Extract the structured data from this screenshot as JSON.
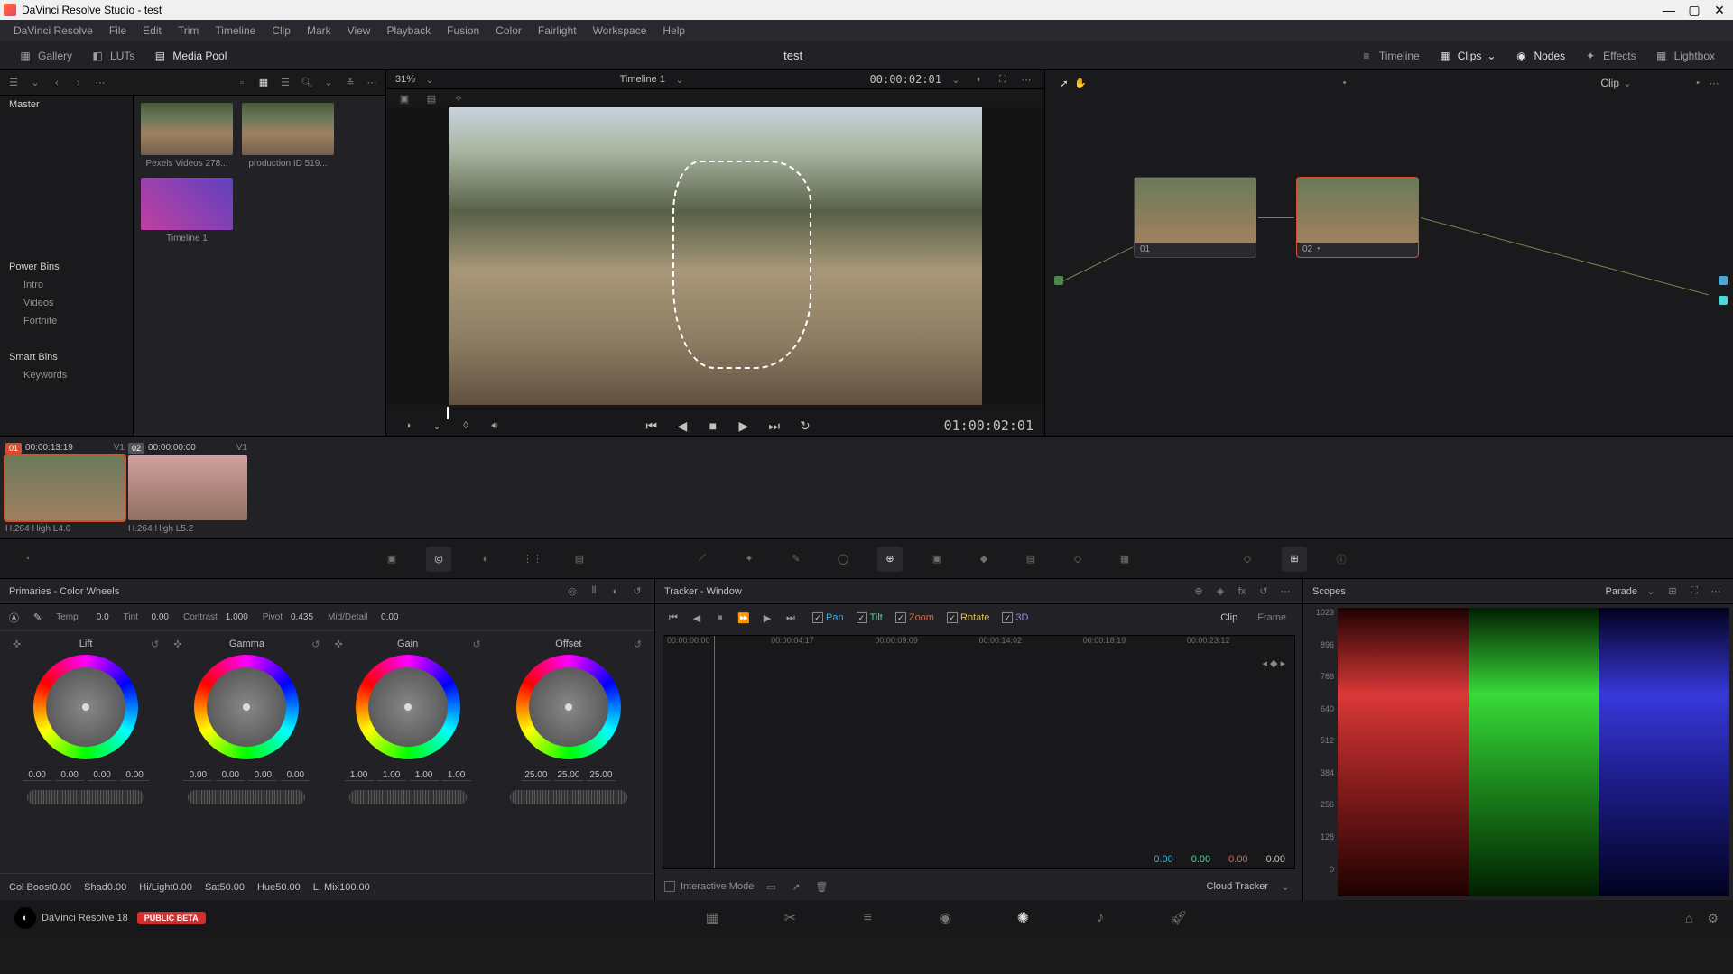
{
  "titlebar": {
    "title": "DaVinci Resolve Studio - test"
  },
  "menu": {
    "items": [
      "DaVinci Resolve",
      "File",
      "Edit",
      "Trim",
      "Timeline",
      "Clip",
      "Mark",
      "View",
      "Playback",
      "Fusion",
      "Color",
      "Fairlight",
      "Workspace",
      "Help"
    ]
  },
  "toolbar": {
    "gallery": "Gallery",
    "luts": "LUTs",
    "mediapool": "Media Pool",
    "project": "test",
    "timeline": "Timeline",
    "clips": "Clips",
    "nodes": "Nodes",
    "effects": "Effects",
    "lightbox": "Lightbox"
  },
  "mediapool": {
    "master": "Master",
    "power": "Power Bins",
    "power_items": [
      "Intro",
      "Videos",
      "Fortnite"
    ],
    "smart": "Smart Bins",
    "smart_items": [
      "Keywords"
    ],
    "clips": [
      "Pexels Videos 278...",
      "production ID 519...",
      "Timeline 1"
    ]
  },
  "viewer": {
    "zoom": "31%",
    "timeline_name": "Timeline 1",
    "tc_small": "00:00:02:01",
    "tc_big": "01:00:02:01"
  },
  "nodes": {
    "mode": "Clip",
    "n1": "01",
    "n2": "02"
  },
  "clipstrip": {
    "c1": {
      "num": "01",
      "tc": "00:00:13:19",
      "v": "V1",
      "codec": "H.264 High L4.0"
    },
    "c2": {
      "num": "02",
      "tc": "00:00:00:00",
      "v": "V1",
      "codec": "H.264 High L5.2"
    }
  },
  "wheels": {
    "header": "Primaries - Color Wheels",
    "params": {
      "temp_l": "Temp",
      "temp": "0.0",
      "tint_l": "Tint",
      "tint": "0.00",
      "contrast_l": "Contrast",
      "contrast": "1.000",
      "pivot_l": "Pivot",
      "pivot": "0.435",
      "mid_l": "Mid/Detail",
      "mid": "0.00"
    },
    "lift": {
      "name": "Lift",
      "v": [
        "0.00",
        "0.00",
        "0.00",
        "0.00"
      ]
    },
    "gamma": {
      "name": "Gamma",
      "v": [
        "0.00",
        "0.00",
        "0.00",
        "0.00"
      ]
    },
    "gain": {
      "name": "Gain",
      "v": [
        "1.00",
        "1.00",
        "1.00",
        "1.00"
      ]
    },
    "offset": {
      "name": "Offset",
      "v": [
        "25.00",
        "25.00",
        "25.00"
      ]
    },
    "params2": {
      "cb_l": "Col Boost",
      "cb": "0.00",
      "sh_l": "Shad",
      "sh": "0.00",
      "hl_l": "Hi/Light",
      "hl": "0.00",
      "sat_l": "Sat",
      "sat": "50.00",
      "hue_l": "Hue",
      "hue": "50.00",
      "lm_l": "L. Mix",
      "lm": "100.00"
    }
  },
  "tracker": {
    "header": "Tracker - Window",
    "pan": "Pan",
    "tilt": "Tilt",
    "zoom": "Zoom",
    "rotate": "Rotate",
    "td": "3D",
    "clip": "Clip",
    "frame": "Frame",
    "marks": [
      "00:00:00:00",
      "00:00:04:17",
      "00:00:09:09",
      "00:00:14:02",
      "00:00:18:19",
      "00:00:23:12"
    ],
    "vals": [
      "0.00",
      "0.00",
      "0.00",
      "0.00"
    ],
    "interactive": "Interactive Mode",
    "cloud": "Cloud Tracker"
  },
  "scopes": {
    "header": "Scopes",
    "mode": "Parade",
    "axis": [
      "1023",
      "896",
      "768",
      "640",
      "512",
      "384",
      "256",
      "128",
      "0"
    ]
  },
  "bnav": {
    "app": "DaVinci Resolve 18",
    "beta": "PUBLIC BETA"
  }
}
